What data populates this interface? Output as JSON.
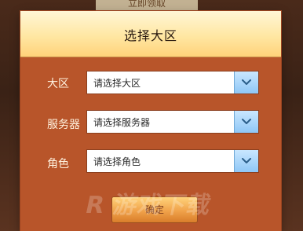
{
  "background": {
    "top_button_label": "立即领取"
  },
  "dialog": {
    "title": "选择大区",
    "rows": [
      {
        "label": "大区",
        "placeholder": "请选择大区"
      },
      {
        "label": "服务器",
        "placeholder": "请选择服务器"
      },
      {
        "label": "角色",
        "placeholder": "请选择角色"
      }
    ],
    "confirm_label": "确定"
  },
  "icons": {
    "dropdown": "chevron-down-icon"
  },
  "watermark": {
    "text": "R 游戏下载"
  },
  "colors": {
    "dialog_bg": "#b8552a",
    "header_bg": "#ffe7a3",
    "dropdown_btn": "#8fc7f6"
  }
}
